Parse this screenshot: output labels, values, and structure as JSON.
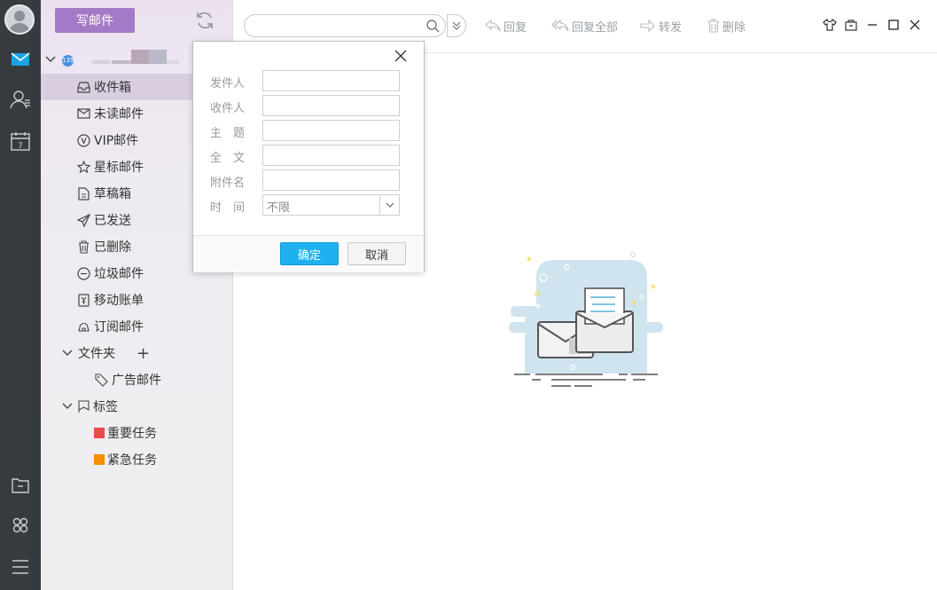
{
  "rail": {
    "icons": [
      "avatar",
      "mail-icon",
      "contacts-icon",
      "calendar-icon",
      "file-manager-icon",
      "apps-icon",
      "menu-icon"
    ],
    "calendar_day": "7"
  },
  "sidebar": {
    "compose_label": "写邮件",
    "account_badge": "139",
    "folders": [
      {
        "label": "收件箱",
        "icon": "inbox-icon"
      },
      {
        "label": "未读邮件",
        "icon": "unread-mail-icon"
      },
      {
        "label": "VIP邮件",
        "icon": "vip-icon"
      },
      {
        "label": "星标邮件",
        "icon": "star-icon"
      },
      {
        "label": "草稿箱",
        "icon": "draft-icon"
      },
      {
        "label": "已发送",
        "icon": "sent-icon"
      },
      {
        "label": "已删除",
        "icon": "trash-icon"
      },
      {
        "label": "垃圾邮件",
        "icon": "spam-icon"
      },
      {
        "label": "移动账单",
        "icon": "bill-icon"
      },
      {
        "label": "订阅邮件",
        "icon": "subscribe-icon"
      }
    ],
    "folder_group": {
      "label": "文件夹",
      "add_symbol": "+"
    },
    "custom_folders": [
      {
        "label": "广告邮件",
        "icon": "tag-folder-icon"
      }
    ],
    "tag_group": {
      "label": "标签"
    },
    "tags": [
      {
        "label": "重要任务",
        "color": "#e84b4b"
      },
      {
        "label": "紧急任务",
        "color": "#f29200"
      }
    ]
  },
  "toolbar": {
    "search_placeholder": "",
    "reply": "回复",
    "reply_all": "回复全部",
    "forward": "转发",
    "delete": "删除"
  },
  "dialog": {
    "fields": [
      {
        "label": "发件人",
        "value": ""
      },
      {
        "label": "收件人",
        "value": ""
      },
      {
        "label": "主　题",
        "value": ""
      },
      {
        "label": "全　文",
        "value": ""
      },
      {
        "label": "附件名",
        "value": ""
      }
    ],
    "time_label": "时　间",
    "time_value": "不限",
    "ok": "确定",
    "cancel": "取消"
  },
  "colors": {
    "accent_purple": "#a37ac6",
    "ok_blue": "#1db2ef",
    "rail_bg": "#363b40"
  }
}
